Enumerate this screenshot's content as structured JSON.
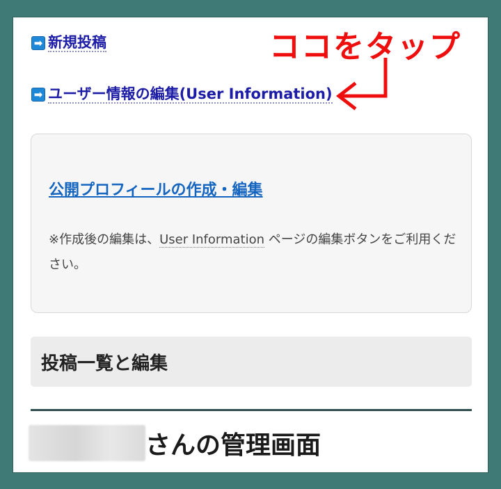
{
  "links": {
    "new_post": "新規投稿",
    "user_info_edit": "ユーザー情報の編集(User Information)",
    "arrow_glyph": "➡"
  },
  "annotation": {
    "text": "ココをタップ",
    "color": "#ef0e0e"
  },
  "profile_card": {
    "link": "公開プロフィールの作成・編集",
    "note_prefix": "※作成後の編集は、",
    "note_link": "User Information",
    "note_suffix": " ページの編集ボタンをご利用ください。"
  },
  "posts_section": {
    "title": "投稿一覧と編集"
  },
  "admin": {
    "title_suffix": "さんの管理画面"
  },
  "colors": {
    "background": "#3f7a76",
    "link": "#1c1ca6",
    "profile_link": "#1465c0",
    "arrow_icon": "#1e88d8"
  }
}
